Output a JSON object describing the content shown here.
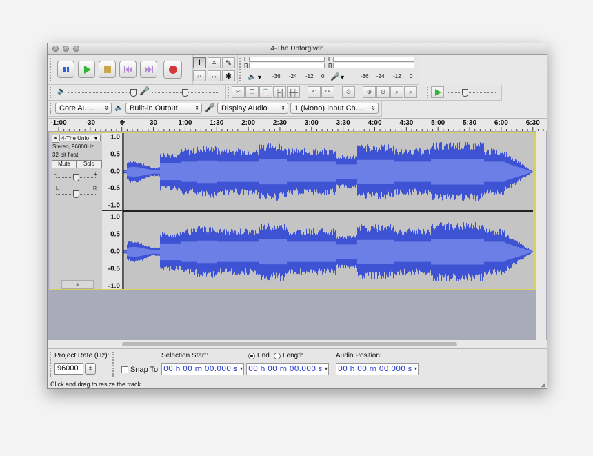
{
  "window": {
    "title": "4-The Unforgiven"
  },
  "meters": {
    "l": "L",
    "r": "R",
    "play_ticks": [
      "-36",
      "-24",
      "-12",
      "0"
    ],
    "rec_ticks": [
      "-36",
      "-24",
      "-12",
      "0"
    ]
  },
  "devices": {
    "host": "Core Au…",
    "output": "Built-in Output",
    "input": "Display Audio",
    "channels": "1 (Mono) Input Ch…"
  },
  "ruler": {
    "labels": [
      "-1:00",
      "-30",
      "0",
      "30",
      "1:00",
      "1:30",
      "2:00",
      "2:30",
      "3:00",
      "3:30",
      "4:00",
      "4:30",
      "5:00",
      "5:30",
      "6:00",
      "6:30"
    ]
  },
  "track": {
    "name": "4-The Unfo",
    "info1": "Stereo, 96000Hz",
    "info2": "32-bit float",
    "mute": "Mute",
    "solo": "Solo",
    "gain_minus": "-",
    "gain_plus": "+",
    "pan_l": "L",
    "pan_r": "R",
    "scale": [
      "1.0",
      "0.5",
      "0.0",
      "-0.5",
      "-1.0"
    ],
    "wave_color": "#3e52d4",
    "rms_color": "#6b7fe6",
    "selection_color": "#d9d25a"
  },
  "bottom": {
    "project_rate_label": "Project Rate (Hz):",
    "project_rate": "96000",
    "snap_to": "Snap To",
    "selection_start_label": "Selection Start:",
    "end_label": "End",
    "length_label": "Length",
    "audio_position_label": "Audio Position:",
    "selection_start": "00 h 00 m 00.000 s",
    "selection_end": "00 h 00 m 00.000 s",
    "audio_position": "00 h 00 m 00.000 s"
  },
  "status": {
    "text": "Click and drag to resize the track."
  }
}
